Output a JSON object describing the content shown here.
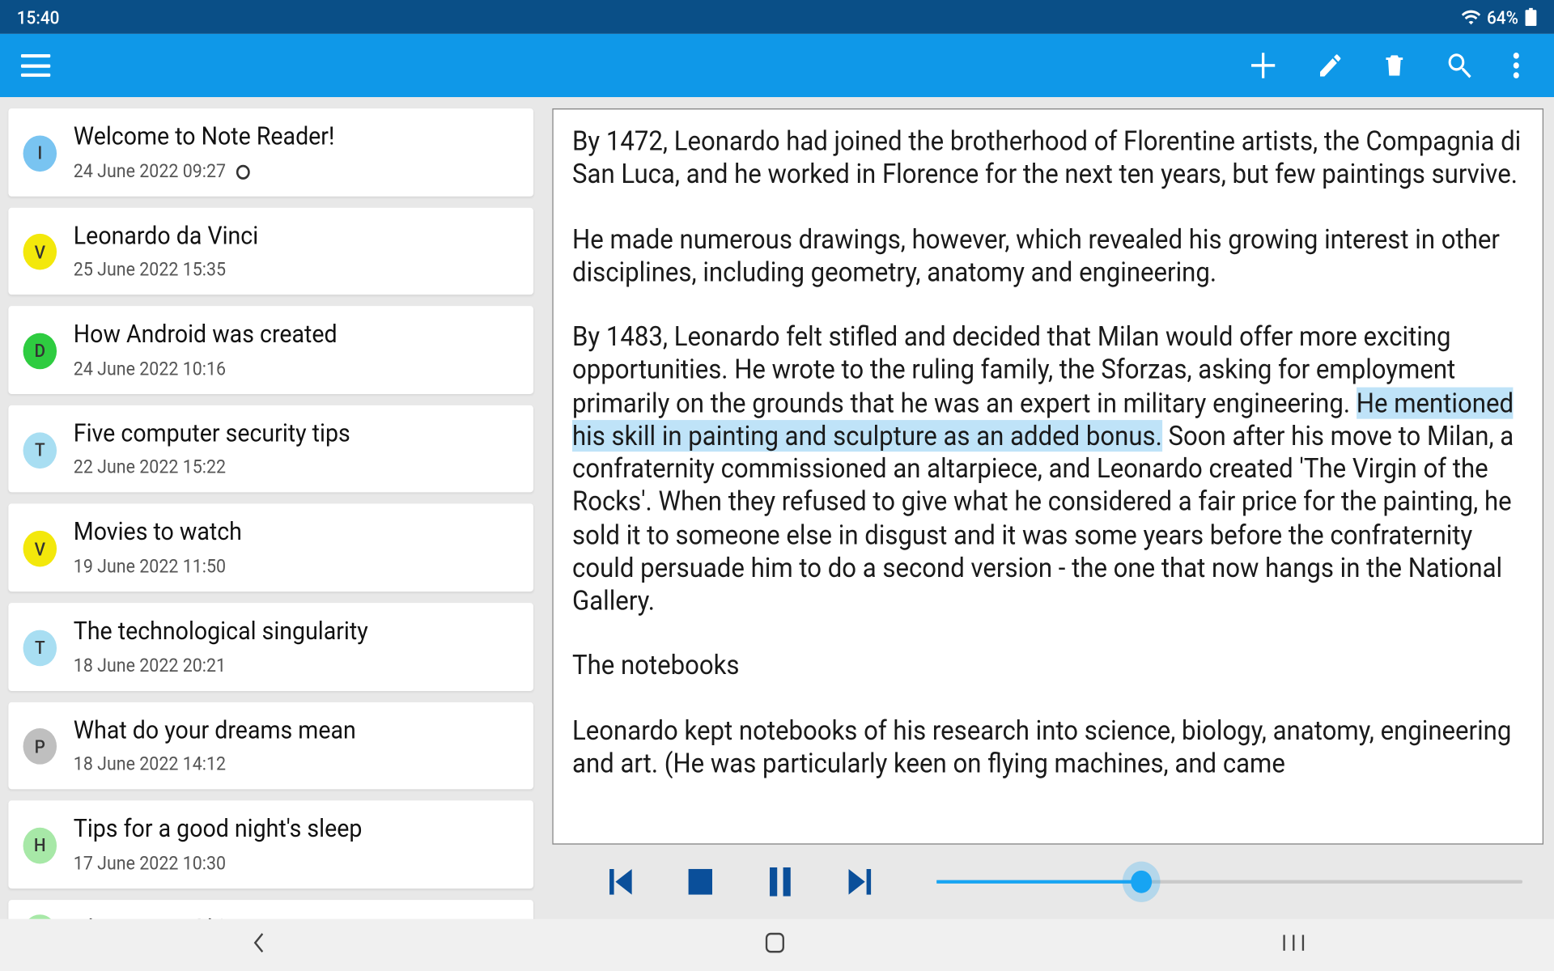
{
  "status": {
    "time": "15:40",
    "battery": "64%"
  },
  "colors": {
    "status_bg": "#0a4f87",
    "appbar_bg": "#0f98e8",
    "player_icon": "#0a4f9a",
    "highlight": "#bfe3f8"
  },
  "list": {
    "items": [
      {
        "avatar": "I",
        "color": "#79c4f1",
        "title": "Welcome to Note Reader!",
        "date": "24 June 2022 09:27",
        "ring": true
      },
      {
        "avatar": "V",
        "color": "#f3e80b",
        "title": "Leonardo da Vinci",
        "date": "25 June 2022 15:35"
      },
      {
        "avatar": "D",
        "color": "#2ecc40",
        "title": "How Android was created",
        "date": "24 June 2022 10:16"
      },
      {
        "avatar": "T",
        "color": "#a8def2",
        "title": "Five computer security tips",
        "date": "22 June 2022 15:22"
      },
      {
        "avatar": "V",
        "color": "#f3e80b",
        "title": "Movies to watch",
        "date": "19 June 2022 11:50"
      },
      {
        "avatar": "T",
        "color": "#a8def2",
        "title": "The technological singularity",
        "date": "18 June 2022 20:21"
      },
      {
        "avatar": "P",
        "color": "#bfbfbf",
        "title": "What do your dreams mean",
        "date": "18 June 2022 14:12"
      },
      {
        "avatar": "H",
        "color": "#a7e8a7",
        "title": "Tips for a good night's sleep",
        "date": "17 June 2022 10:30"
      },
      {
        "avatar": "H",
        "color": "#a7e8a7",
        "title": "Blue zones Okinawan",
        "date": ""
      }
    ]
  },
  "note": {
    "p1": "By 1472, Leonardo had joined the brotherhood of Florentine artists, the Compagnia di San Luca, and he worked in Florence for the next ten years, but few paintings survive.",
    "p2": "He made numerous drawings, however, which revealed his growing interest in other disciplines, including geometry, anatomy and engineering.",
    "p3_a": "By 1483, Leonardo felt stifled and decided that Milan would offer more exciting opportunities. He wrote to the ruling family, the Sforzas, asking for employment primarily on the grounds that he was an expert in military engineering. ",
    "p3_hl": "He mentioned his skill in painting and sculpture as an added bonus.",
    "p3_b": " Soon after his move to Milan, a confraternity commissioned an altarpiece, and Leonardo created 'The Virgin of the Rocks'. When they refused to give what he considered a fair price for the painting, he sold it to someone else in disgust and it was some years before the confraternity could persuade him to do a second version - the one that now hangs in the National Gallery.",
    "p4": "The notebooks",
    "p5": "Leonardo kept notebooks of his research into science, biology, anatomy, engineering and art. (He was particularly keen on flying machines, and came"
  },
  "player": {
    "progress_pct": 35
  }
}
